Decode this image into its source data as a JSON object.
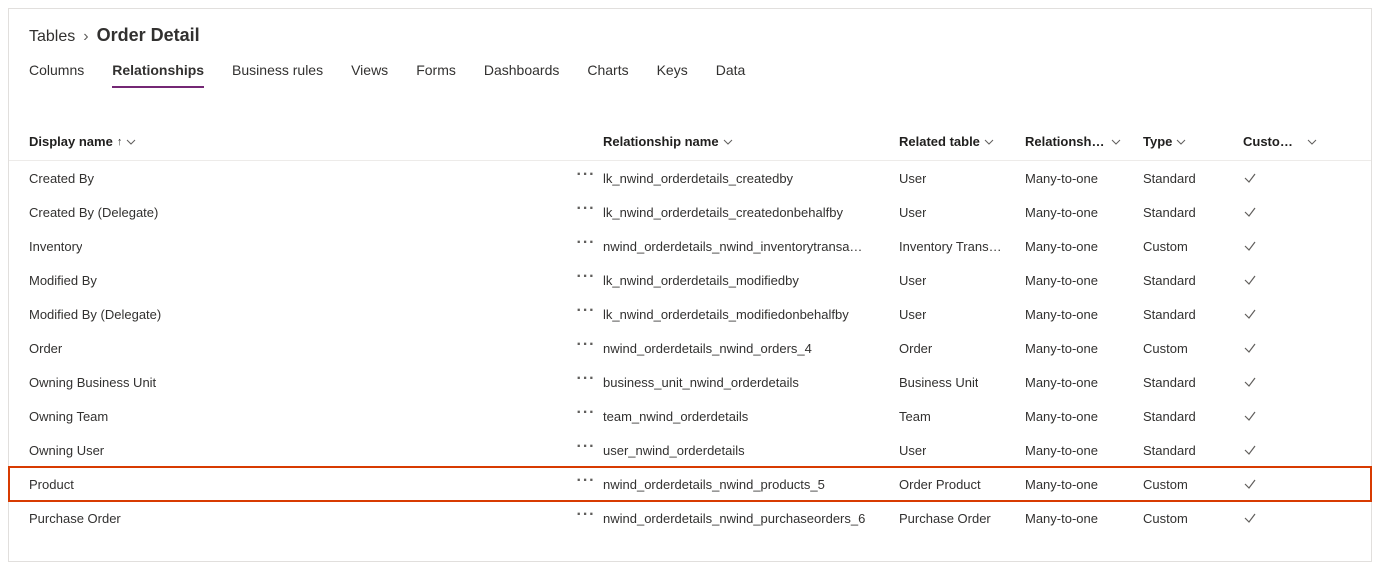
{
  "breadcrumb": {
    "parent": "Tables",
    "chevron": "›",
    "current": "Order Detail"
  },
  "tabs": {
    "items": [
      {
        "label": "Columns",
        "active": false
      },
      {
        "label": "Relationships",
        "active": true
      },
      {
        "label": "Business rules",
        "active": false
      },
      {
        "label": "Views",
        "active": false
      },
      {
        "label": "Forms",
        "active": false
      },
      {
        "label": "Dashboards",
        "active": false
      },
      {
        "label": "Charts",
        "active": false
      },
      {
        "label": "Keys",
        "active": false
      },
      {
        "label": "Data",
        "active": false
      }
    ]
  },
  "columns": {
    "display_name": "Display name",
    "sort_indicator": "↑",
    "relationship_name": "Relationship name",
    "related_table": "Related table",
    "relationship_type": "Relationshi…",
    "type": "Type",
    "customizable": "Custom…"
  },
  "rows": [
    {
      "display": "Created By",
      "rel": "lk_nwind_orderdetails_createdby",
      "table": "User",
      "rtype": "Many-to-one",
      "type": "Standard",
      "cust": true,
      "highlight": false
    },
    {
      "display": "Created By (Delegate)",
      "rel": "lk_nwind_orderdetails_createdonbehalfby",
      "table": "User",
      "rtype": "Many-to-one",
      "type": "Standard",
      "cust": true,
      "highlight": false
    },
    {
      "display": "Inventory",
      "rel": "nwind_orderdetails_nwind_inventorytransa…",
      "table": "Inventory Trans…",
      "rtype": "Many-to-one",
      "type": "Custom",
      "cust": true,
      "highlight": false
    },
    {
      "display": "Modified By",
      "rel": "lk_nwind_orderdetails_modifiedby",
      "table": "User",
      "rtype": "Many-to-one",
      "type": "Standard",
      "cust": true,
      "highlight": false
    },
    {
      "display": "Modified By (Delegate)",
      "rel": "lk_nwind_orderdetails_modifiedonbehalfby",
      "table": "User",
      "rtype": "Many-to-one",
      "type": "Standard",
      "cust": true,
      "highlight": false
    },
    {
      "display": "Order",
      "rel": "nwind_orderdetails_nwind_orders_4",
      "table": "Order",
      "rtype": "Many-to-one",
      "type": "Custom",
      "cust": true,
      "highlight": false
    },
    {
      "display": "Owning Business Unit",
      "rel": "business_unit_nwind_orderdetails",
      "table": "Business Unit",
      "rtype": "Many-to-one",
      "type": "Standard",
      "cust": true,
      "highlight": false
    },
    {
      "display": "Owning Team",
      "rel": "team_nwind_orderdetails",
      "table": "Team",
      "rtype": "Many-to-one",
      "type": "Standard",
      "cust": true,
      "highlight": false
    },
    {
      "display": "Owning User",
      "rel": "user_nwind_orderdetails",
      "table": "User",
      "rtype": "Many-to-one",
      "type": "Standard",
      "cust": true,
      "highlight": false
    },
    {
      "display": "Product",
      "rel": "nwind_orderdetails_nwind_products_5",
      "table": "Order Product",
      "rtype": "Many-to-one",
      "type": "Custom",
      "cust": true,
      "highlight": true
    },
    {
      "display": "Purchase Order",
      "rel": "nwind_orderdetails_nwind_purchaseorders_6",
      "table": "Purchase Order",
      "rtype": "Many-to-one",
      "type": "Custom",
      "cust": true,
      "highlight": false
    }
  ]
}
